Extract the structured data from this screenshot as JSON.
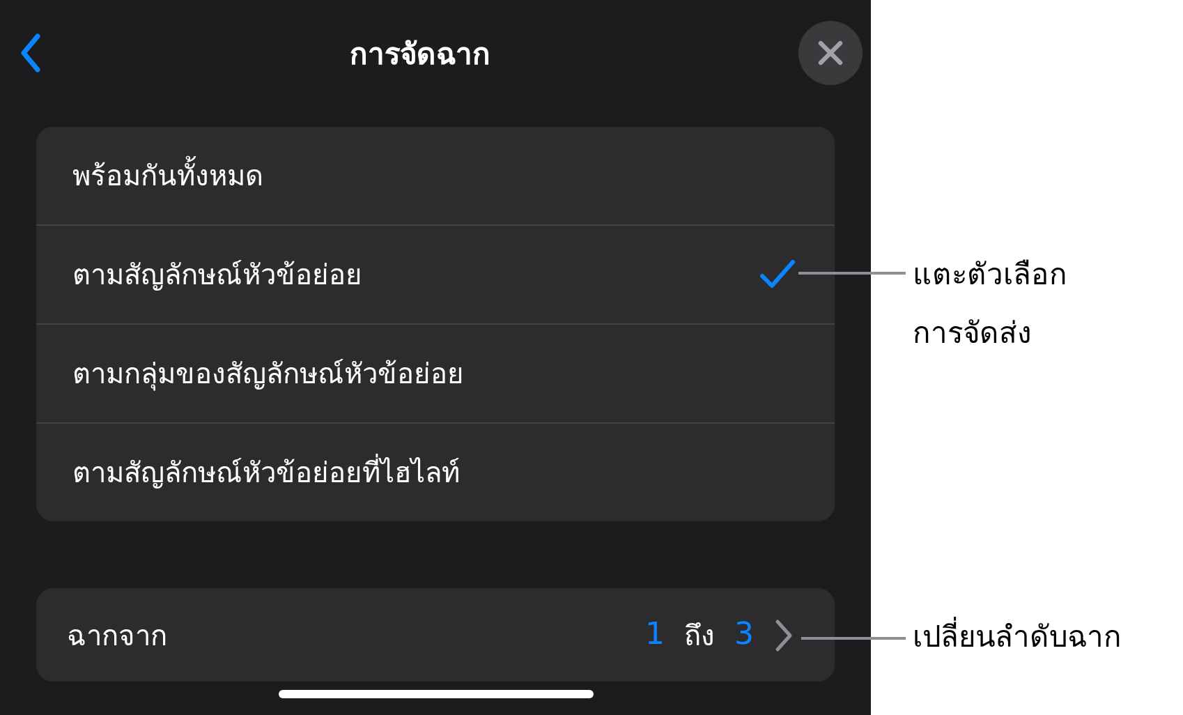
{
  "header": {
    "title": "การจัดฉาก"
  },
  "options": [
    {
      "label": "พร้อมกันทั้งหมด",
      "selected": false
    },
    {
      "label": "ตามสัญลักษณ์หัวข้อย่อย",
      "selected": true
    },
    {
      "label": "ตามกลุ่มของสัญลักษณ์หัวข้อย่อย",
      "selected": false
    },
    {
      "label": "ตามสัญลักษณ์หัวข้อย่อยที่ไฮไลท์",
      "selected": false
    }
  ],
  "range": {
    "label": "ฉากจาก",
    "from": "1",
    "separator": "ถึง",
    "to": "3"
  },
  "callouts": [
    {
      "text": "แตะตัวเลือก การจัดส่ง"
    },
    {
      "text": "เปลี่ยนลำดับฉาก"
    }
  ]
}
